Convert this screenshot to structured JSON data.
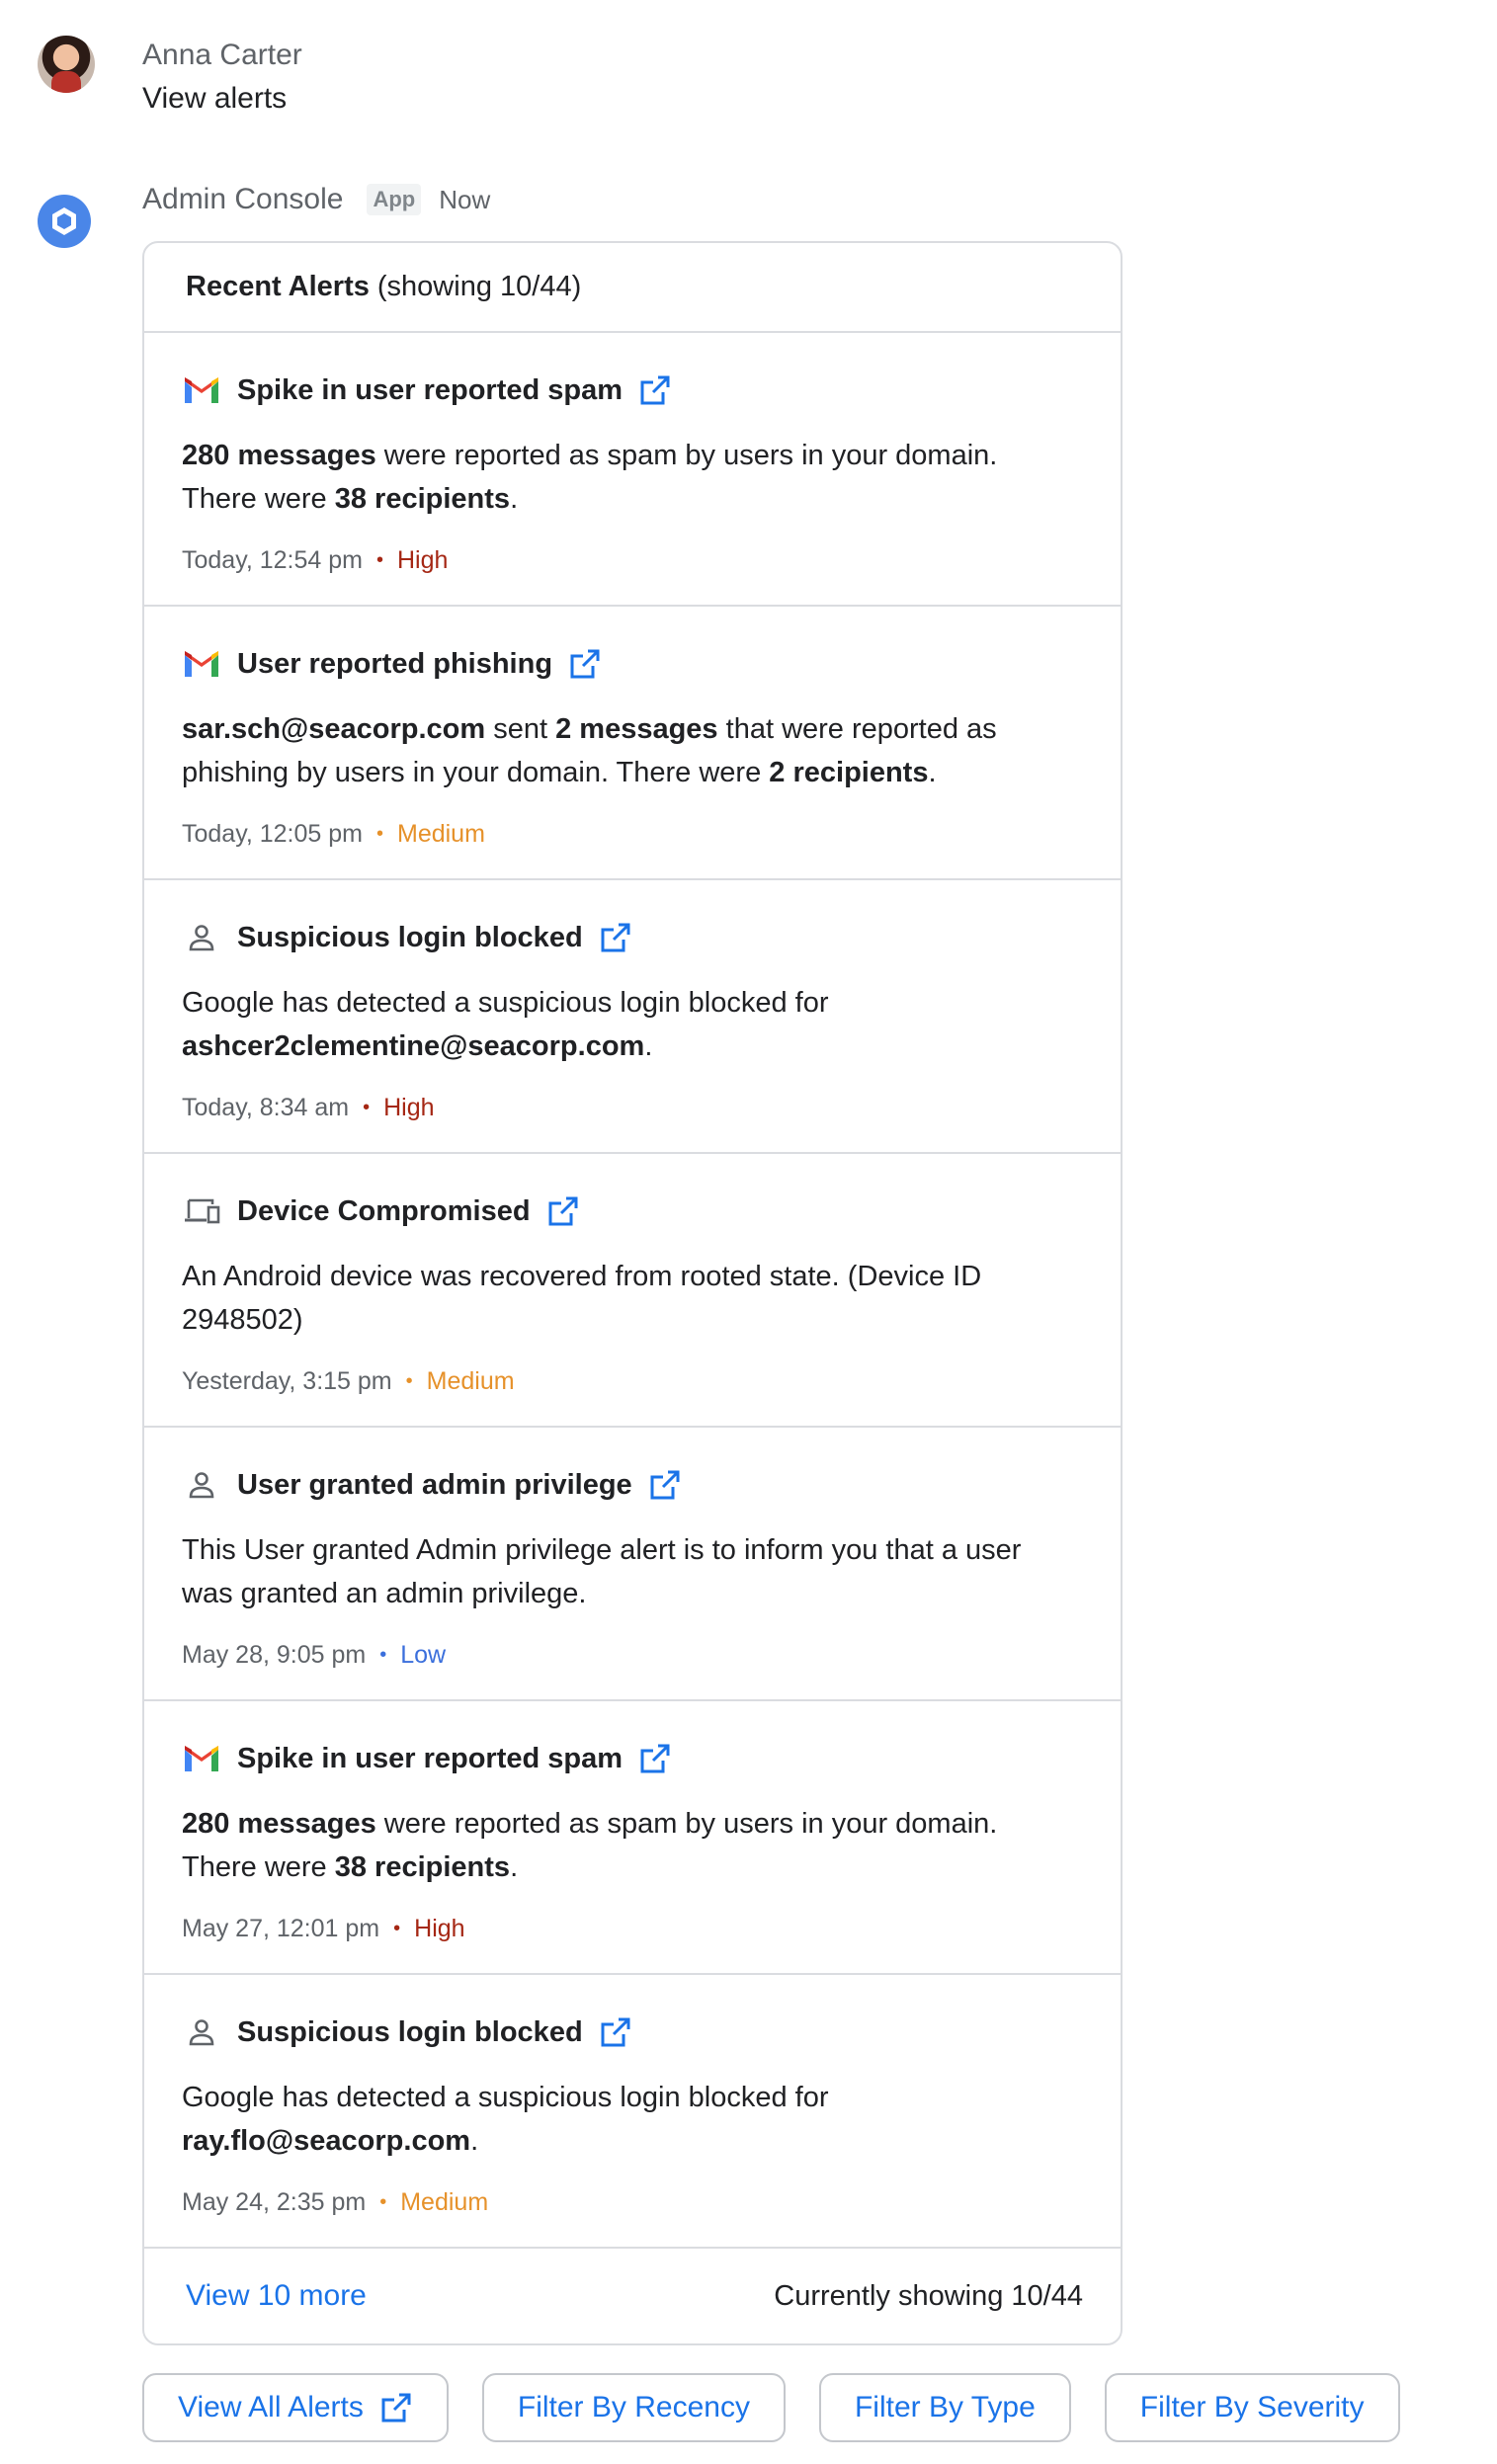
{
  "user": {
    "name": "Anna Carter",
    "message": "View alerts"
  },
  "app": {
    "name": "Admin Console",
    "chip": "App",
    "time": "Now"
  },
  "card": {
    "title_bold": "Recent Alerts",
    "title_rest": "(showing 10/44)",
    "alerts": [
      {
        "icon": "gmail-icon",
        "title": "Spike in user reported spam",
        "body_parts": [
          {
            "text": "280 messages",
            "bold": true
          },
          {
            "text": " were reported as spam by users in your domain. There were ",
            "bold": false
          },
          {
            "text": "38 recipients",
            "bold": true
          },
          {
            "text": ".",
            "bold": false
          }
        ],
        "time": "Today, 12:54 pm",
        "severity": "High"
      },
      {
        "icon": "gmail-icon",
        "title": "User reported phishing",
        "body_parts": [
          {
            "text": "sar.sch@seacorp.com",
            "bold": true
          },
          {
            "text": " sent ",
            "bold": false
          },
          {
            "text": "2 messages",
            "bold": true
          },
          {
            "text": " that were reported as phishing by users in your domain. There were ",
            "bold": false
          },
          {
            "text": "2 recipients",
            "bold": true
          },
          {
            "text": ".",
            "bold": false
          }
        ],
        "time": "Today, 12:05 pm",
        "severity": "Medium"
      },
      {
        "icon": "person-icon",
        "title": "Suspicious login blocked",
        "body_parts": [
          {
            "text": "Google has detected a suspicious login blocked for ",
            "bold": false
          },
          {
            "text": "ashcer2clementine@seacorp.com",
            "bold": true
          },
          {
            "text": ".",
            "bold": false
          }
        ],
        "time": "Today, 8:34 am",
        "severity": "High"
      },
      {
        "icon": "devices-icon",
        "title": "Device Compromised",
        "body_parts": [
          {
            "text": "An Android device was recovered from rooted state. (Device ID 2948502)",
            "bold": false
          }
        ],
        "time": "Yesterday, 3:15 pm",
        "severity": "Medium"
      },
      {
        "icon": "person-icon",
        "title": "User granted admin privilege",
        "body_parts": [
          {
            "text": "This User granted Admin privilege alert is to inform you that a user was granted an admin privilege.",
            "bold": false
          }
        ],
        "time": "May 28, 9:05 pm",
        "severity": "Low"
      },
      {
        "icon": "gmail-icon",
        "title": "Spike in user reported spam",
        "body_parts": [
          {
            "text": "280 messages",
            "bold": true
          },
          {
            "text": " were reported as spam by users in your domain. There were ",
            "bold": false
          },
          {
            "text": "38 recipients",
            "bold": true
          },
          {
            "text": ".",
            "bold": false
          }
        ],
        "time": "May 27, 12:01 pm",
        "severity": "High"
      },
      {
        "icon": "person-icon",
        "title": "Suspicious login blocked",
        "body_parts": [
          {
            "text": "Google has detected a suspicious login blocked for ",
            "bold": false
          },
          {
            "text": "ray.flo@seacorp.com",
            "bold": true
          },
          {
            "text": ".",
            "bold": false
          }
        ],
        "time": "May 24, 2:35 pm",
        "severity": "Medium"
      }
    ],
    "footer_link": "View 10 more",
    "footer_status": "Currently showing 10/44"
  },
  "actions": [
    {
      "label": "View All Alerts",
      "icon": "open-in-new-icon"
    },
    {
      "label": "Filter By Recency"
    },
    {
      "label": "Filter By Type"
    },
    {
      "label": "Filter By Severity"
    }
  ],
  "colors": {
    "accent": "#1a73e8",
    "severity_high": "#a52714",
    "severity_medium": "#e6912a",
    "severity_low": "#3b6fdc"
  }
}
